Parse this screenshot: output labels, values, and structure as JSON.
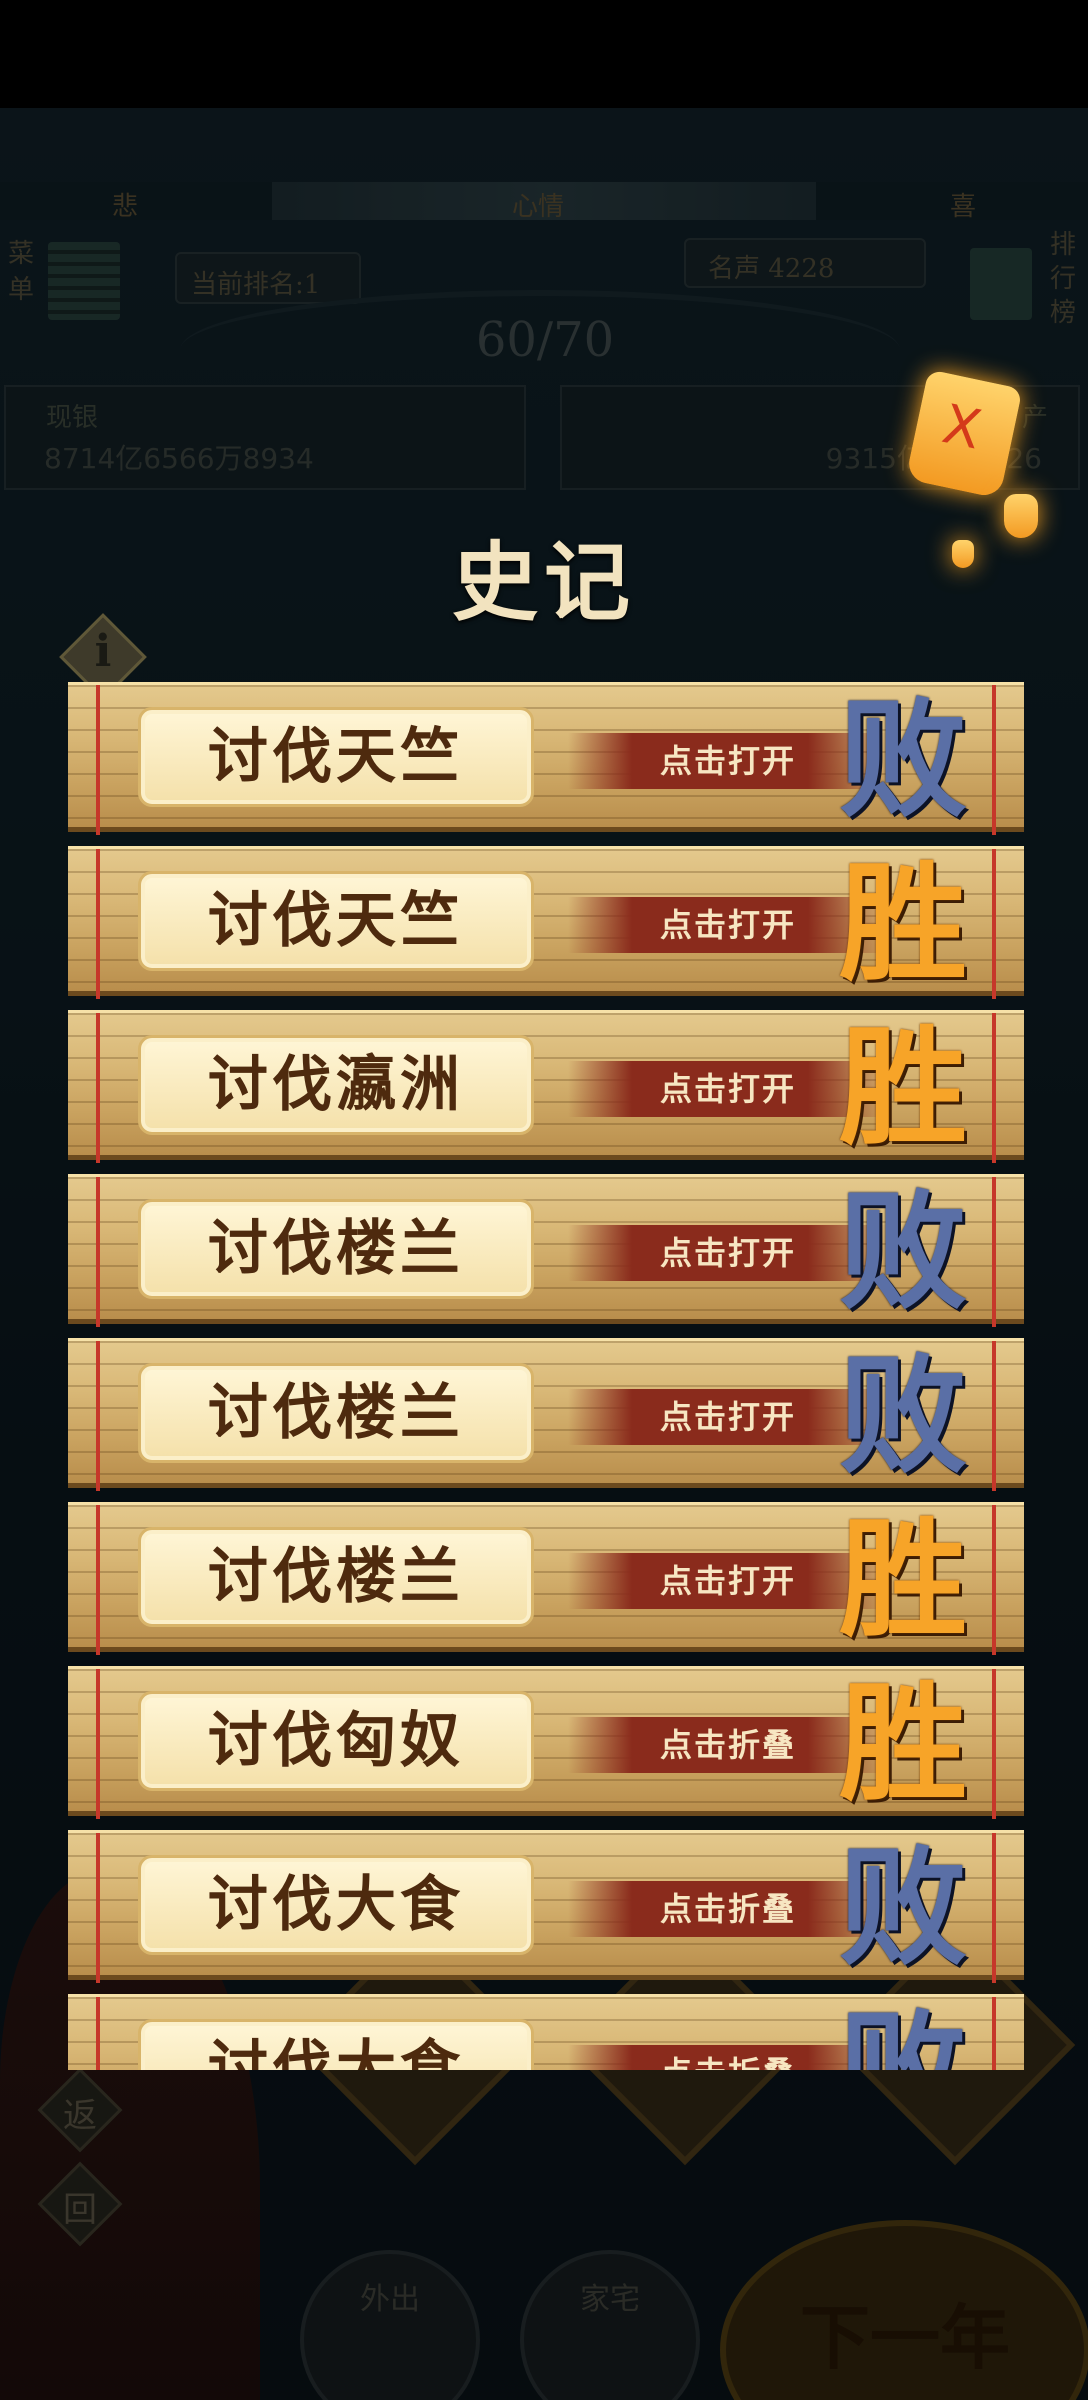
{
  "status_bar": {},
  "mood": {
    "left": "悲",
    "center": "心情",
    "right": "喜"
  },
  "hud": {
    "menu": "菜\n单",
    "rank": "当前排名:1",
    "fame": "名声 4228",
    "leaderboard": "排\n行\n榜",
    "progress": "60/70"
  },
  "money": {
    "left_label": "现银",
    "left_value": "8714亿6566万8934",
    "right_label": "产",
    "right_value": "9315亿35…426"
  },
  "panel": {
    "title": "史记"
  },
  "records": [
    {
      "name": "讨伐天竺",
      "action": "点击打开",
      "result": "败",
      "outcome": "lose"
    },
    {
      "name": "讨伐天竺",
      "action": "点击打开",
      "result": "胜",
      "outcome": "win"
    },
    {
      "name": "讨伐瀛洲",
      "action": "点击打开",
      "result": "胜",
      "outcome": "win"
    },
    {
      "name": "讨伐楼兰",
      "action": "点击打开",
      "result": "败",
      "outcome": "lose"
    },
    {
      "name": "讨伐楼兰",
      "action": "点击打开",
      "result": "败",
      "outcome": "lose"
    },
    {
      "name": "讨伐楼兰",
      "action": "点击打开",
      "result": "胜",
      "outcome": "win"
    },
    {
      "name": "讨伐匈奴",
      "action": "点击折叠",
      "result": "胜",
      "outcome": "win"
    },
    {
      "name": "讨伐大食",
      "action": "点击折叠",
      "result": "败",
      "outcome": "lose"
    },
    {
      "name": "讨伐大食",
      "action": "点击折叠",
      "result": "败",
      "outcome": "lose"
    }
  ],
  "bottom": {
    "back_1": "返",
    "back_2": "回",
    "outing": "外出",
    "home": "家宅",
    "next_year": "下一年"
  }
}
